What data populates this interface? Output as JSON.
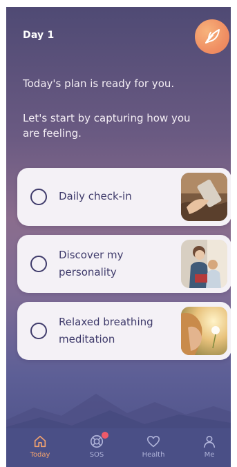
{
  "header": {
    "title": "Day 1"
  },
  "intro": {
    "line1": "Today's plan is ready for you.",
    "line2": "Let's start by capturing how you are feeling."
  },
  "tasks": [
    {
      "label": "Daily check-in",
      "done": false,
      "image_icon": "hand-holding-phone-photo"
    },
    {
      "label": "Discover my personality",
      "done": false,
      "image_icon": "family-photo"
    },
    {
      "label": "Relaxed breathing meditation",
      "done": false,
      "image_icon": "woman-blowing-dandelion-photo"
    }
  ],
  "tabs": [
    {
      "label": "Today",
      "icon": "home-icon",
      "active": true
    },
    {
      "label": "SOS",
      "icon": "lifebuoy-icon",
      "active": false,
      "badge": true
    },
    {
      "label": "Health",
      "icon": "heart-icon",
      "active": false
    },
    {
      "label": "Me",
      "icon": "person-icon",
      "active": false
    }
  ],
  "colors": {
    "accent": "#f1a26f",
    "text_dark": "#3f3b6b",
    "card_bg": "#f4f1f6",
    "tabbar_bg": "#4a4f86",
    "badge": "#ee5a6a"
  }
}
